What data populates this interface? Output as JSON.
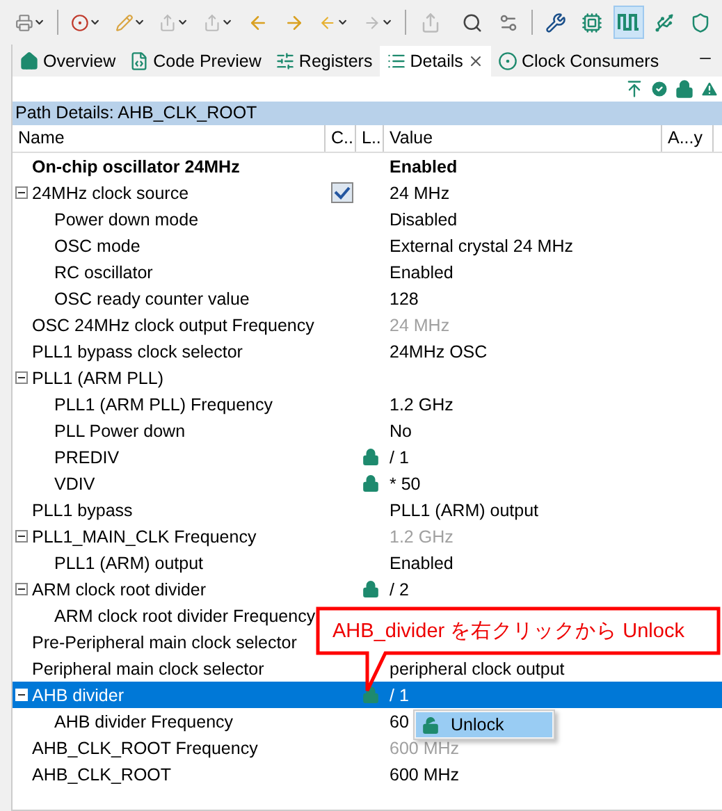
{
  "tabs": [
    {
      "label": "Overview",
      "selected": false
    },
    {
      "label": "Code Preview",
      "selected": false
    },
    {
      "label": "Registers",
      "selected": false
    },
    {
      "label": "Details",
      "selected": true
    },
    {
      "label": "Clock Consumers",
      "selected": false
    }
  ],
  "path_details": "Path Details: AHB_CLK_ROOT",
  "table": {
    "columns": [
      "Name",
      "C...",
      "L...",
      "Value",
      "A...y"
    ],
    "rows": [
      {
        "name": "On-chip oscillator 24MHz",
        "value": "Enabled",
        "bold": true,
        "selected": false
      },
      {
        "name": "24MHz clock source",
        "value": "24 MHz",
        "checked": true,
        "selected": false,
        "expanded": true,
        "children": [
          {
            "name": "Power down mode",
            "value": "Disabled",
            "selected": false
          },
          {
            "name": "OSC mode",
            "value": "External crystal 24 MHz",
            "selected": false
          },
          {
            "name": "RC oscillator",
            "value": "Enabled",
            "selected": false
          },
          {
            "name": "OSC ready counter value",
            "value": "128",
            "selected": false
          }
        ]
      },
      {
        "name": "OSC 24MHz clock output Frequency",
        "value": "24 MHz",
        "dimmed": true,
        "selected": false
      },
      {
        "name": "PLL1 bypass clock selector",
        "value": "24MHz OSC",
        "selected": false
      },
      {
        "name": "PLL1 (ARM PLL)",
        "selected": false,
        "expanded": true,
        "children": [
          {
            "name": "PLL1 (ARM PLL) Frequency",
            "value": "1.2 GHz",
            "selected": false
          },
          {
            "name": "PLL Power down",
            "value": "No",
            "selected": false
          },
          {
            "name": "PREDIV",
            "value": "/ 1",
            "locked": true,
            "selected": false
          },
          {
            "name": "VDIV",
            "value": "* 50",
            "locked": true,
            "selected": false
          }
        ]
      },
      {
        "name": "PLL1 bypass",
        "value": "PLL1 (ARM) output",
        "selected": false
      },
      {
        "name": "PLL1_MAIN_CLK Frequency",
        "value": "1.2 GHz",
        "dimmed": true,
        "selected": false,
        "expanded": true,
        "children": [
          {
            "name": "PLL1 (ARM) output",
            "value": "Enabled",
            "selected": false
          }
        ]
      },
      {
        "name": "ARM clock root divider",
        "value": "/ 2",
        "locked": true,
        "selected": false,
        "expanded": true,
        "children": [
          {
            "name": "ARM clock root divider Frequency",
            "selected": false
          }
        ]
      },
      {
        "name": "Pre-Peripheral main clock selector",
        "selected": false
      },
      {
        "name": "Peripheral main clock selector",
        "value": "peripheral clock output",
        "selected": false
      },
      {
        "name": "AHB divider",
        "value": "/ 1",
        "locked": true,
        "selected": true,
        "expanded": true,
        "children": [
          {
            "name": "AHB divider Frequency",
            "value": "60",
            "selected": false
          }
        ]
      },
      {
        "name": "AHB_CLK_ROOT Frequency",
        "value": "600 MHz",
        "dimmed": true,
        "selected": false
      },
      {
        "name": "AHB_CLK_ROOT",
        "value": "600 MHz",
        "selected": false
      }
    ]
  },
  "context_menu": {
    "items": [
      {
        "label": "Unlock",
        "selected": true
      }
    ]
  },
  "callout": {
    "text": "AHB_divider を右クリックから Unlock"
  }
}
